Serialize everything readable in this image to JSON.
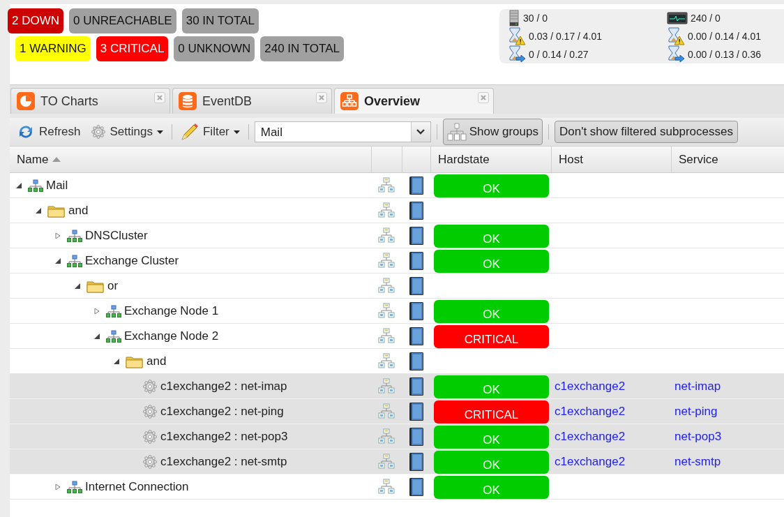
{
  "host_badges": [
    {
      "label": "2 DOWN",
      "color": "#cc0000"
    },
    {
      "label": "0 UNREACHABLE",
      "color": "#a0a0a0"
    },
    {
      "label": "30 IN TOTAL",
      "color": "#a0a0a0"
    }
  ],
  "service_badges": [
    {
      "label": "1 WARNING",
      "color": "#ffff00"
    },
    {
      "label": "3 CRITICAL",
      "color": "#ff0000"
    },
    {
      "label": "0 UNKNOWN",
      "color": "#a0a0a0"
    },
    {
      "label": "240 IN TOTAL",
      "color": "#a0a0a0"
    }
  ],
  "stats": [
    {
      "kind": "hosts",
      "value": "30 / 0"
    },
    {
      "kind": "services",
      "value": "240 / 0"
    },
    {
      "kind": "latency",
      "value": "0.03 / 0.17 / 4.01"
    },
    {
      "kind": "latency",
      "value": "0.00 / 0.14 / 4.01"
    },
    {
      "kind": "execution",
      "value": "0 / 0.14 / 0.27"
    },
    {
      "kind": "execution",
      "value": "0.00 / 0.13 / 0.36"
    }
  ],
  "tabs": [
    {
      "label": "TO Charts",
      "kind": "charts",
      "selected": false
    },
    {
      "label": "EventDB",
      "kind": "database",
      "selected": false
    },
    {
      "label": "Overview",
      "kind": "overview",
      "selected": true
    }
  ],
  "toolbar": {
    "refresh": "Refresh",
    "settings": "Settings",
    "filter": "Filter",
    "process_field": {
      "value": "Mail"
    },
    "show_groups": "Show groups",
    "filtered_toggle": "Don't show filtered subprocesses"
  },
  "table": {
    "columns": [
      "Name",
      "Hardstate",
      "Host",
      "Service"
    ],
    "rows": [
      {
        "name": "Mail",
        "kind": "process",
        "expanded": true,
        "hardstate": {
          "label": "OK",
          "color": "#00cc00"
        },
        "children": [
          {
            "name": "and",
            "kind": "group",
            "expanded": true,
            "children": [
              {
                "name": "DNSCluster",
                "kind": "process",
                "expanded": false,
                "hardstate": {
                  "label": "OK",
                  "color": "#00cc00"
                }
              },
              {
                "name": "Exchange Cluster",
                "kind": "process",
                "expanded": true,
                "hardstate": {
                  "label": "OK",
                  "color": "#00cc00"
                },
                "children": [
                  {
                    "name": "or",
                    "kind": "group",
                    "expanded": true,
                    "children": [
                      {
                        "name": "Exchange Node 1",
                        "kind": "process",
                        "expanded": false,
                        "hardstate": {
                          "label": "OK",
                          "color": "#00cc00"
                        }
                      },
                      {
                        "name": "Exchange Node 2",
                        "kind": "process",
                        "expanded": true,
                        "hardstate": {
                          "label": "CRITICAL",
                          "color": "#ff0000"
                        },
                        "children": [
                          {
                            "name": "and",
                            "kind": "group",
                            "expanded": true,
                            "children": [
                              {
                                "name": "c1exchange2 : net-imap",
                                "kind": "service",
                                "hardstate": {
                                  "label": "OK",
                                  "color": "#00cc00"
                                },
                                "host": "c1exchange2",
                                "service": "net-imap"
                              },
                              {
                                "name": "c1exchange2 : net-ping",
                                "kind": "service",
                                "hardstate": {
                                  "label": "CRITICAL",
                                  "color": "#ff0000"
                                },
                                "host": "c1exchange2",
                                "service": "net-ping"
                              },
                              {
                                "name": "c1exchange2 : net-pop3",
                                "kind": "service",
                                "hardstate": {
                                  "label": "OK",
                                  "color": "#00cc00"
                                },
                                "host": "c1exchange2",
                                "service": "net-pop3"
                              },
                              {
                                "name": "c1exchange2 : net-smtp",
                                "kind": "service",
                                "hardstate": {
                                  "label": "OK",
                                  "color": "#00cc00"
                                },
                                "host": "c1exchange2",
                                "service": "net-smtp"
                              }
                            ]
                          }
                        ]
                      }
                    ]
                  }
                ]
              },
              {
                "name": "Internet Connection",
                "kind": "process",
                "expanded": false,
                "hardstate": {
                  "label": "OK",
                  "color": "#00cc00"
                }
              }
            ]
          }
        ]
      }
    ]
  }
}
